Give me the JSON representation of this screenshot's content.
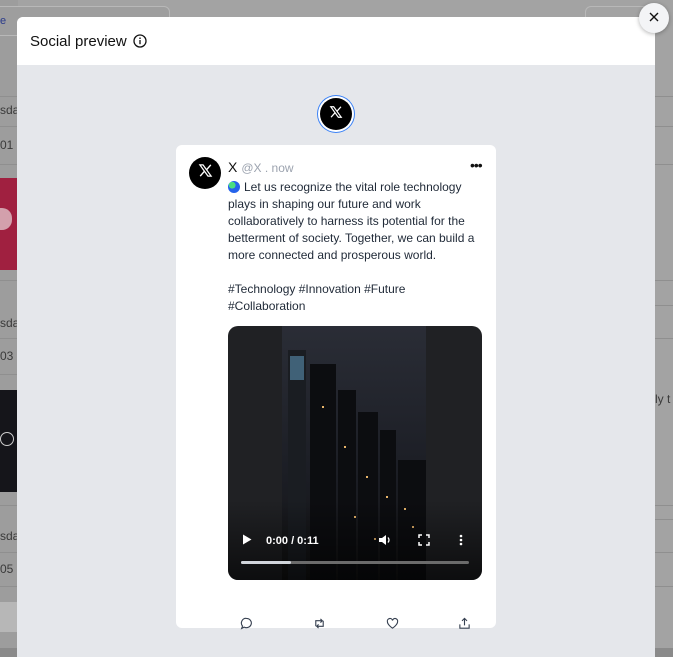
{
  "modal": {
    "title": "Social preview"
  },
  "post": {
    "author": "X",
    "meta": "@X . now",
    "text": "Let us recognize the vital role technology plays in shaping our future and work collaboratively to harness its potential for the betterment of society. Together, we can build a more connected and prosperous world.\n\n#Technology #Innovation #Future #Collaboration",
    "more": "•••"
  },
  "video": {
    "time": "0:00 / 0:11",
    "progress_fraction": 0.22
  },
  "background": {
    "tag": "e",
    "row_labels": [
      "sda",
      "01",
      "sda",
      "03",
      "sda",
      "05"
    ],
    "right_text": "ly t"
  },
  "icons": {
    "info": "info-icon",
    "close": "close-icon",
    "platform": "x-logo-icon",
    "reply": "reply-icon",
    "repost": "repost-icon",
    "like": "heart-icon",
    "share": "share-icon"
  },
  "colors": {
    "accent": "#3b82f6",
    "modal_bg": "#e5e7eb"
  }
}
